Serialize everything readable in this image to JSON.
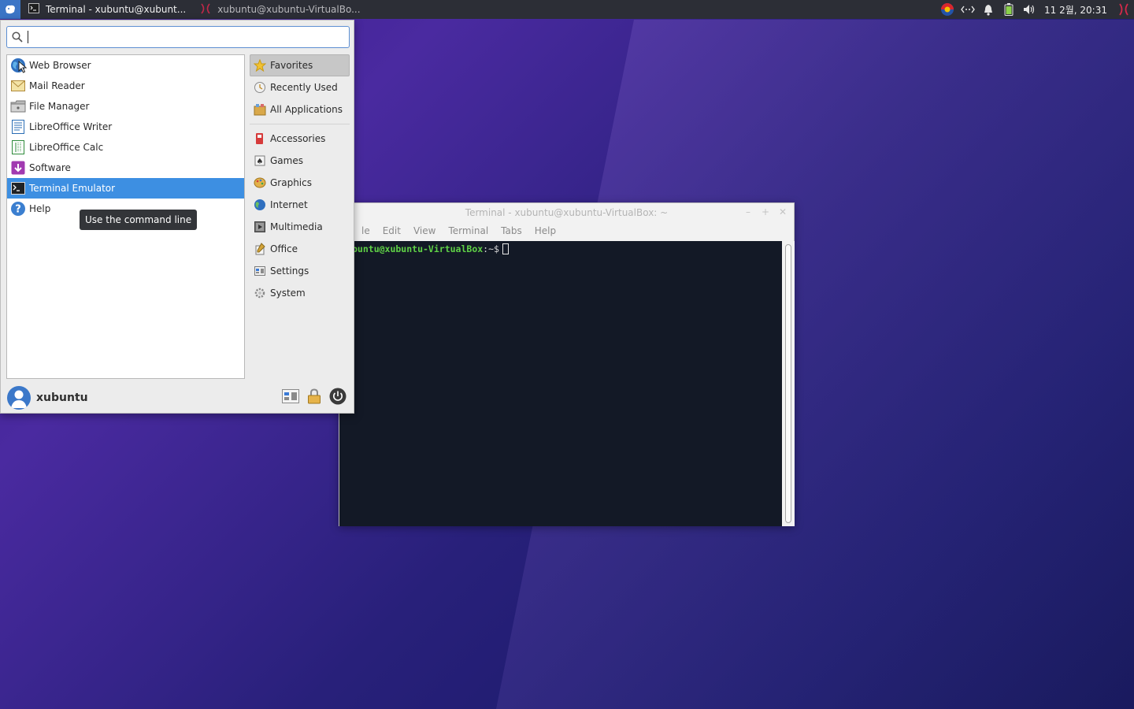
{
  "panel": {
    "tasks": [
      {
        "label": "Terminal - xubuntu@xubunt...",
        "icon": "terminal-icon",
        "active": true
      },
      {
        "label": "xubuntu@xubuntu-VirtualBo...",
        "icon": "xfce-icon",
        "active": false
      }
    ],
    "tray_icons": [
      "input-method-icon",
      "network-icon",
      "notification-bell-icon",
      "battery-icon",
      "volume-icon"
    ],
    "clock": "11 2월, 20:31"
  },
  "terminal_window": {
    "title": "Terminal - xubuntu@xubuntu-VirtualBox: ~",
    "menu": [
      "le",
      "Edit",
      "View",
      "Terminal",
      "Tabs",
      "Help"
    ],
    "prompt_user": "buntu@xubuntu-VirtualBox",
    "prompt_path": ":~$"
  },
  "whisker_menu": {
    "search": {
      "value": "",
      "placeholder": ""
    },
    "apps": [
      {
        "label": "Web Browser",
        "icon": "web-browser-icon"
      },
      {
        "label": "Mail Reader",
        "icon": "mail-reader-icon"
      },
      {
        "label": "File Manager",
        "icon": "file-manager-icon"
      },
      {
        "label": "LibreOffice Writer",
        "icon": "libreoffice-writer-icon"
      },
      {
        "label": "LibreOffice Calc",
        "icon": "libreoffice-calc-icon"
      },
      {
        "label": "Software",
        "icon": "software-icon"
      },
      {
        "label": "Terminal Emulator",
        "icon": "terminal-icon",
        "selected": true
      },
      {
        "label": "Help",
        "icon": "help-icon"
      }
    ],
    "tooltip": "Use the command line",
    "categories_top": [
      {
        "label": "Favorites",
        "icon": "star-icon",
        "selected": true
      },
      {
        "label": "Recently Used",
        "icon": "clock-icon"
      },
      {
        "label": "All Applications",
        "icon": "applications-icon"
      }
    ],
    "categories": [
      {
        "label": "Accessories",
        "icon": "accessories-icon"
      },
      {
        "label": "Games",
        "icon": "games-icon"
      },
      {
        "label": "Graphics",
        "icon": "graphics-icon"
      },
      {
        "label": "Internet",
        "icon": "internet-icon"
      },
      {
        "label": "Multimedia",
        "icon": "multimedia-icon"
      },
      {
        "label": "Office",
        "icon": "office-icon"
      },
      {
        "label": "Settings",
        "icon": "settings-icon"
      },
      {
        "label": "System",
        "icon": "system-icon"
      }
    ],
    "user": "xubuntu",
    "footer_buttons": [
      "settings-manager-icon",
      "lock-icon",
      "power-icon"
    ]
  },
  "colors": {
    "selection": "#3d8fe2",
    "panel": "#2c2e36",
    "terminal_bg": "#131926",
    "prompt_green": "#5fd146"
  }
}
